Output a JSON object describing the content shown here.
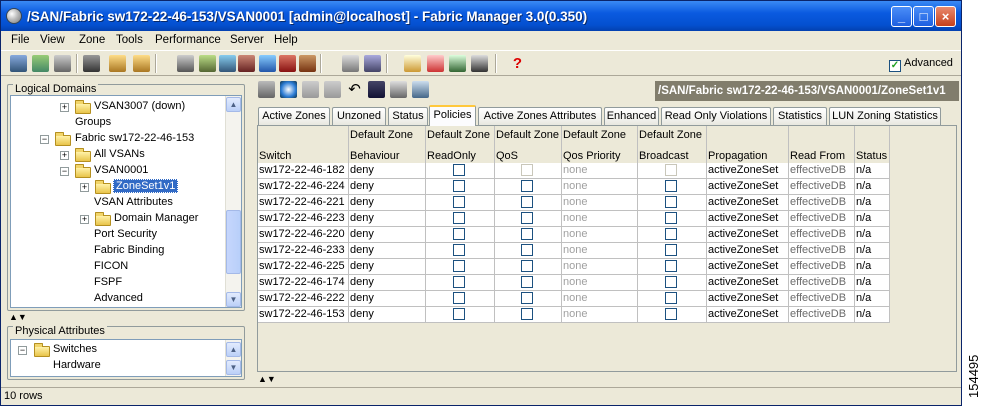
{
  "window": {
    "title": "/SAN/Fabric sw172-22-46-153/VSAN0001 [admin@localhost] - Fabric Manager 3.0(0.350)"
  },
  "menu": [
    "File",
    "View",
    "Zone",
    "Tools",
    "Performance",
    "Server",
    "Help"
  ],
  "toolbar": {
    "advanced_label": "Advanced",
    "advanced_checked": true
  },
  "logical_domains": {
    "title": "Logical Domains",
    "nodes": [
      {
        "label": "VSAN3007 (down)"
      },
      {
        "label": "Groups"
      },
      {
        "label": "Fabric sw172-22-46-153"
      },
      {
        "label": "All VSANs"
      },
      {
        "label": "VSAN0001"
      },
      {
        "label": "ZoneSet1v1"
      },
      {
        "label": "VSAN Attributes"
      },
      {
        "label": "Domain Manager"
      },
      {
        "label": "Port Security"
      },
      {
        "label": "Fabric Binding"
      },
      {
        "label": "FICON"
      },
      {
        "label": "FSPF"
      },
      {
        "label": "Advanced"
      }
    ]
  },
  "physical_attributes": {
    "title": "Physical Attributes",
    "nodes": [
      {
        "label": "Switches"
      },
      {
        "label": "Hardware"
      }
    ]
  },
  "path_label": "/SAN/Fabric sw172-22-46-153/VSAN0001/ZoneSet1v1",
  "tabs": [
    "Active Zones",
    "Unzoned",
    "Status",
    "Policies",
    "Active Zones Attributes",
    "Enhanced",
    "Read Only Violations",
    "Statistics",
    "LUN Zoning Statistics"
  ],
  "active_tab": "Policies",
  "table": {
    "columns": [
      {
        "top": "",
        "bottom": "Switch"
      },
      {
        "top": "Default Zone",
        "bottom": "Behaviour"
      },
      {
        "top": "Default Zone",
        "bottom": "ReadOnly"
      },
      {
        "top": "Default Zone",
        "bottom": "QoS"
      },
      {
        "top": "Default Zone",
        "bottom": "Qos Priority"
      },
      {
        "top": "Default Zone",
        "bottom": "Broadcast"
      },
      {
        "top": "",
        "bottom": "Propagation"
      },
      {
        "top": "",
        "bottom": "Read From"
      },
      {
        "top": "",
        "bottom": "Status"
      }
    ],
    "rows": [
      {
        "switch": "sw172-22-46-182",
        "behaviour": "deny",
        "qos_priority": "none",
        "propagation": "activeZoneSet",
        "read_from": "effectiveDB",
        "status": "n/a"
      },
      {
        "switch": "sw172-22-46-224",
        "behaviour": "deny",
        "qos_priority": "none",
        "propagation": "activeZoneSet",
        "read_from": "effectiveDB",
        "status": "n/a"
      },
      {
        "switch": "sw172-22-46-221",
        "behaviour": "deny",
        "qos_priority": "none",
        "propagation": "activeZoneSet",
        "read_from": "effectiveDB",
        "status": "n/a"
      },
      {
        "switch": "sw172-22-46-223",
        "behaviour": "deny",
        "qos_priority": "none",
        "propagation": "activeZoneSet",
        "read_from": "effectiveDB",
        "status": "n/a"
      },
      {
        "switch": "sw172-22-46-220",
        "behaviour": "deny",
        "qos_priority": "none",
        "propagation": "activeZoneSet",
        "read_from": "effectiveDB",
        "status": "n/a"
      },
      {
        "switch": "sw172-22-46-233",
        "behaviour": "deny",
        "qos_priority": "none",
        "propagation": "activeZoneSet",
        "read_from": "effectiveDB",
        "status": "n/a"
      },
      {
        "switch": "sw172-22-46-225",
        "behaviour": "deny",
        "qos_priority": "none",
        "propagation": "activeZoneSet",
        "read_from": "effectiveDB",
        "status": "n/a"
      },
      {
        "switch": "sw172-22-46-174",
        "behaviour": "deny",
        "qos_priority": "none",
        "propagation": "activeZoneSet",
        "read_from": "effectiveDB",
        "status": "n/a"
      },
      {
        "switch": "sw172-22-46-222",
        "behaviour": "deny",
        "qos_priority": "none",
        "propagation": "activeZoneSet",
        "read_from": "effectiveDB",
        "status": "n/a"
      },
      {
        "switch": "sw172-22-46-153",
        "behaviour": "deny",
        "qos_priority": "none",
        "propagation": "activeZoneSet",
        "read_from": "effectiveDB",
        "status": "n/a"
      }
    ]
  },
  "statusbar": {
    "text": "10 rows"
  },
  "figure_id": "154495",
  "colors": {
    "title_bar": "#0a5ae0",
    "path_bar": "#817d6c",
    "selection": "#316ac5"
  }
}
